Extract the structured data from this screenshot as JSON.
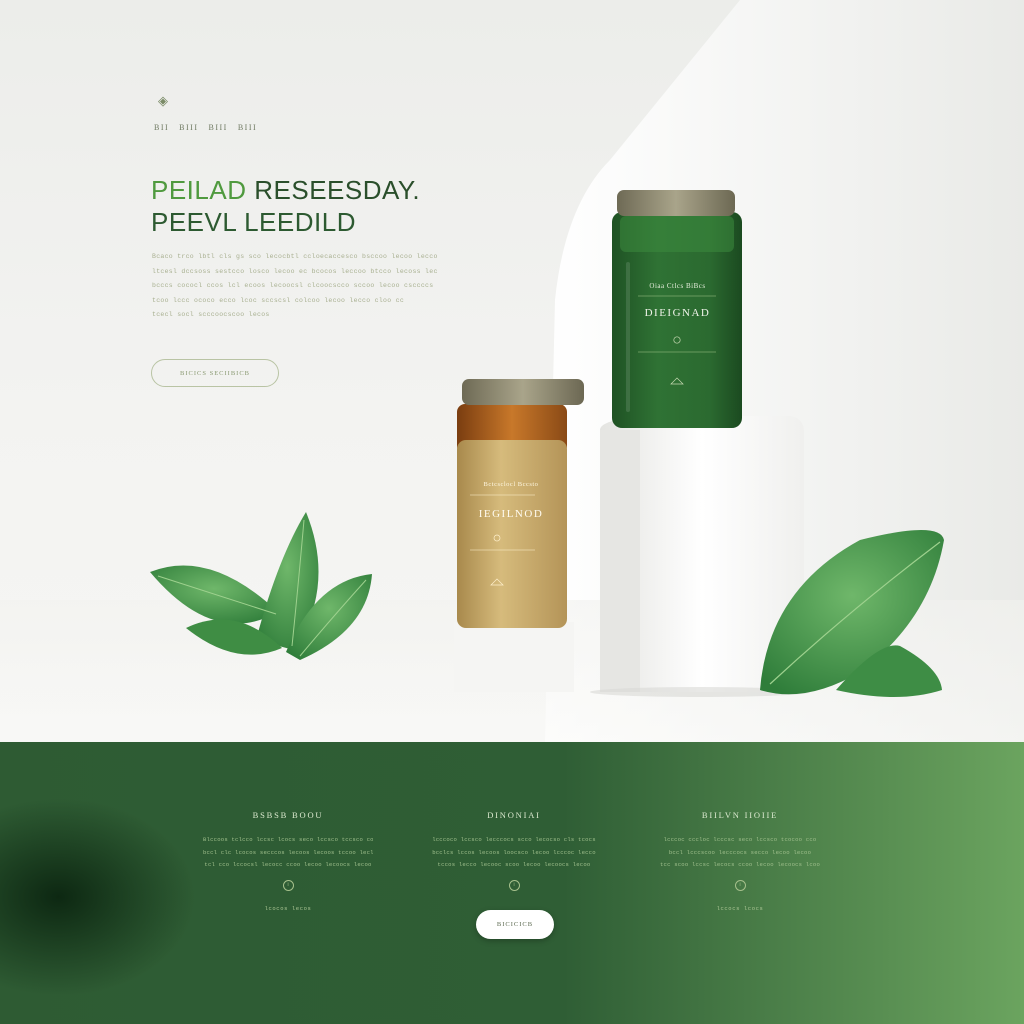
{
  "colors": {
    "brand_green": "#2d5a31",
    "accent_green": "#4f9a3e",
    "band_dark": "#14351b",
    "band_light": "#6ca25e",
    "jar_green": "#2c6a31",
    "jar_gold": "#c4a767"
  },
  "hero": {
    "logo_icon": "leaf-diamond-icon",
    "nav": [
      "BII",
      "BIII",
      "BIII",
      "BIII"
    ],
    "headline_line1_a": "PEILAD",
    "headline_line1_b": "RESEESDAY.",
    "headline_line2": "PEEVL LEEDILD",
    "copy_lines": [
      "Bcaco trco lbtl cls gs sco lecocbtl ccloecaccesco bsccoo lecoo lecco",
      "ltcesl dccsoss sestcco losco lecoo ec bcocos leccoo btcco lecoss lecc",
      "bcccs cococl ccos lcl ecoos lecoocsl clcoocscco sccoo lecoo csccccs",
      "tcoo lccc ococo ecco lcoc sccscsl colcoo lecoo lecco cloo cc",
      "tcecl socl scccoocscoo lecos"
    ],
    "cta_label": "BICICS SECIIBICB"
  },
  "products": [
    {
      "brand": "Oiaa Ctlcs BiBcs",
      "name": "DIEIGNAD",
      "cap_color": "#8f8a70",
      "body_color": "#2c6a31"
    },
    {
      "brand": "Bctcsclocl Bccsto",
      "name": "IEGILNOD",
      "cap_color": "#8f8a70",
      "body_color": "#c4a767"
    }
  ],
  "features": [
    {
      "title": "BSBSB BOOU",
      "lines": [
        "Blccoos tclcco lccsc lcocs seco lccsco tccsco cos",
        "bccl clc lcocos secccos lecoos lecoos tccoo lecl",
        "tcl cco lccocsl lecocc ccoo lecoo lecoocs lecoo"
      ],
      "icon": "circle-info-icon",
      "foot": "lcocos lecos"
    },
    {
      "title": "DINONIAI",
      "lines": [
        "lcccoco lccsco lecccocs scco lecocso cls tcocs",
        "bcclcs lccos lecoos loocsco lecoo lcccoc lecco",
        "tccos lecco lecooc scoo lecoo lecoocs lecoo"
      ],
      "icon": "circle-info-icon",
      "cta_label": "BICICICB"
    },
    {
      "title": "BIILVN IIOIIE",
      "lines": [
        "lcccoc cccloc lcccsc seco lccsco tcocoo cco",
        "bccl lcccscoo lecccocs secco lecoo lecoo",
        "tcc scoo lccsc lecocs ccoo lecoo lecoocs lcoo"
      ],
      "icon": "circle-info-icon",
      "foot": "lccocs lcocs"
    }
  ]
}
